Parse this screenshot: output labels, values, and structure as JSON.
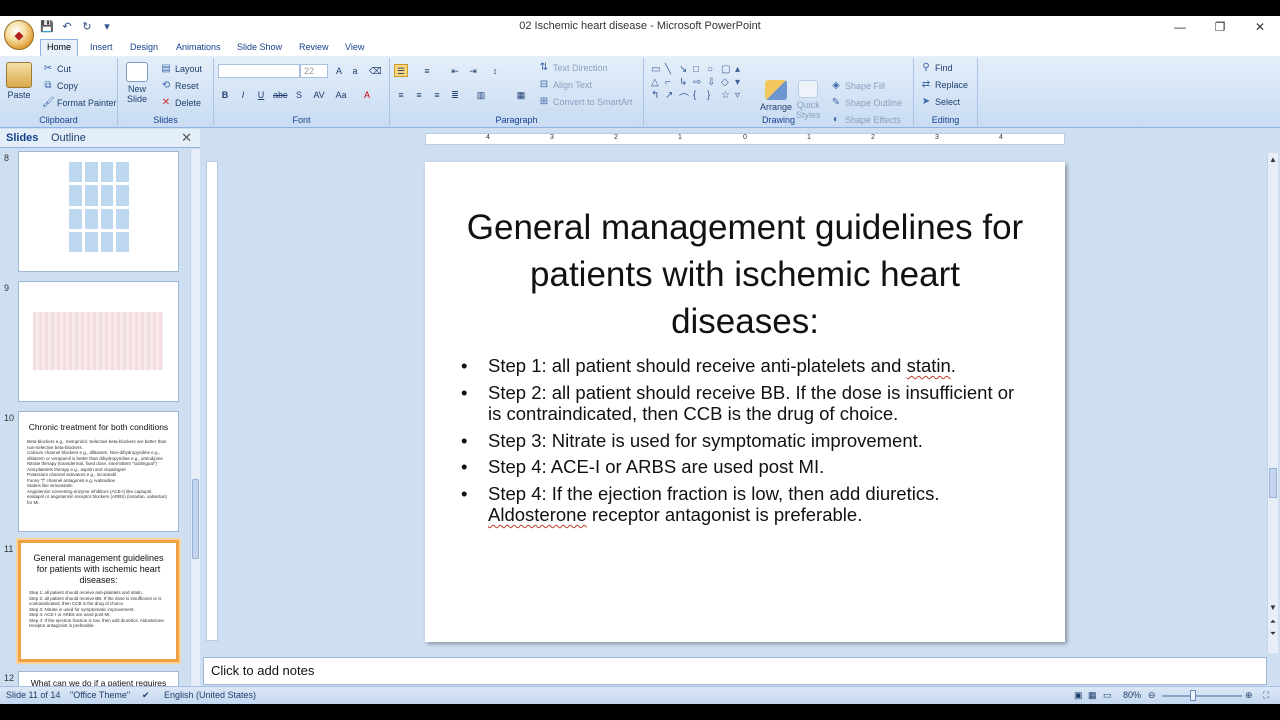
{
  "window": {
    "title": "02 Ischemic heart disease - Microsoft PowerPoint",
    "minimize": "—",
    "restore": "❐",
    "close": "✕"
  },
  "tabs": [
    "Home",
    "Insert",
    "Design",
    "Animations",
    "Slide Show",
    "Review",
    "View"
  ],
  "ribbon": {
    "clipboard": {
      "label": "Clipboard",
      "paste": "Paste",
      "cut": "Cut",
      "copy": "Copy",
      "format_painter": "Format Painter"
    },
    "slides": {
      "label": "Slides",
      "new_slide": "New",
      "new_slide2": "Slide",
      "layout": "Layout",
      "reset": "Reset",
      "delete": "Delete"
    },
    "font": {
      "label": "Font",
      "font_size": "22"
    },
    "paragraph": {
      "label": "Paragraph",
      "text_direction": "Text Direction",
      "align_text": "Align Text",
      "convert_smartart": "Convert to SmartArt"
    },
    "drawing": {
      "label": "Drawing",
      "arrange": "Arrange",
      "quick_styles": "Quick",
      "quick_styles2": "Styles",
      "shape_fill": "Shape Fill",
      "shape_outline": "Shape Outline",
      "shape_effects": "Shape Effects"
    },
    "editing": {
      "label": "Editing",
      "find": "Find",
      "replace": "Replace",
      "select": "Select"
    }
  },
  "panel": {
    "tab_slides": "Slides",
    "tab_outline": "Outline",
    "thumbs": [
      {
        "num": "8"
      },
      {
        "num": "9"
      },
      {
        "num": "10",
        "title": "Chronic treatment for both conditions",
        "lines": [
          "Beta-blockers e.g., metoprolol. Selective beta-blockers are better than non-selective beta-blockers.",
          "Calcium channel blockers e.g., diltiazem. Non-dihydropyridine e.g., diltiazem or verapamil is better than dihydropyridine e.g., amlodipine",
          "Nitrate therapy (transdermal, fixed dose, intermittent \"sublingual\")",
          "Anti-platelets therapy e.g., aspirin and clopidogrel",
          "Potassium channel activators e.g., nicorandil",
          "Funny \"f\" channel antagonist e.g. ivabradine",
          "Statins like simvastatin",
          "Angiotensin converting enzyme inhibitors (ACE-I) like captopril, enalapril or angiotensin receptor blockers (ARBS) (losartan, valsartan) for MI."
        ]
      },
      {
        "num": "11",
        "title": "General management guidelines for patients with ischemic heart diseases:",
        "lines": [
          "Step 1: all patient should receive anti-platelets and statin.",
          "Step 2: all patient should receive BB. If the dose is insufficient or is contraindicated, then CCB is the drug of choice.",
          "Step 3: Nitrate is used for symptomatic improvement.",
          "Step 4: ACE-I or ARBS are used post MI.",
          "Step 4: If the ejection fraction is low, then add diuretics. Aldosterone receptor antagonist is preferable."
        ]
      },
      {
        "num": "12",
        "title": "What can we do if a patient requires non-"
      }
    ]
  },
  "slide": {
    "title": "General management guidelines for patients with ischemic heart diseases:",
    "bullets": [
      {
        "before": "Step 1: all patient should receive anti-platelets and ",
        "mark": "statin",
        "after": "."
      },
      {
        "before": "Step 2: all patient should receive BB. If the dose is insufficient or is contraindicated, then CCB is the drug of choice.",
        "mark": "",
        "after": ""
      },
      {
        "before": "Step 3: Nitrate is used for symptomatic improvement.",
        "mark": "",
        "after": ""
      },
      {
        "before": "Step 4: ACE-I or ARBS are used post MI.",
        "mark": "",
        "after": ""
      },
      {
        "before": "Step 4: If the ejection fraction is low, then add diuretics. ",
        "mark": "Aldosterone",
        "after": " receptor antagonist is preferable."
      }
    ]
  },
  "ruler": {
    "labels": [
      "4",
      "3",
      "2",
      "1",
      "0",
      "1",
      "2",
      "3",
      "4"
    ]
  },
  "notes": {
    "placeholder": "Click to add notes"
  },
  "status": {
    "slide_info": "Slide 11 of 14",
    "theme": "\"Office Theme\"",
    "language": "English (United States)",
    "zoom": "80%"
  }
}
